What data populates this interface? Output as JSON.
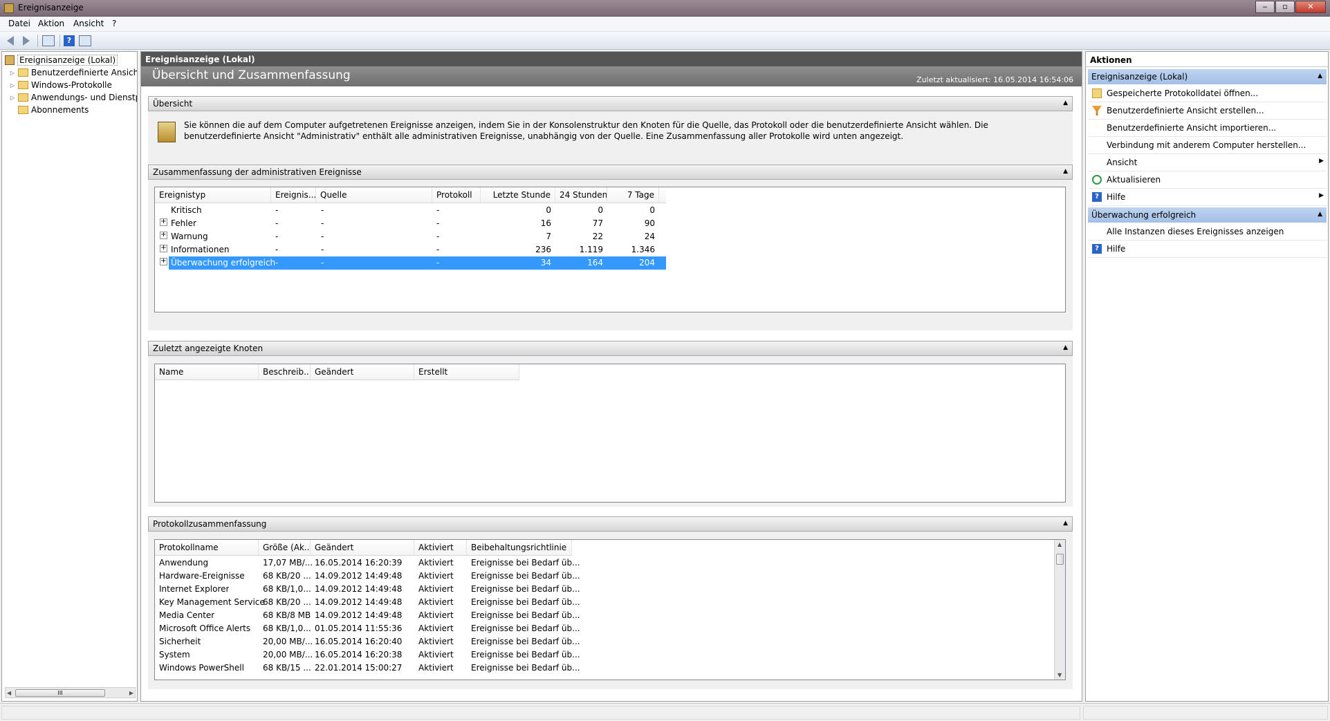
{
  "window": {
    "title": "Ereignisanzeige"
  },
  "menu": [
    "Datei",
    "Aktion",
    "Ansicht",
    "?"
  ],
  "toolbar": {
    "icons": [
      "back-arrow-icon",
      "forward-arrow-icon",
      "show-hide-console-tree-icon",
      "help-icon",
      "show-hide-action-pane-icon"
    ]
  },
  "tree": {
    "root": "Ereignisanzeige (Lokal)",
    "items": [
      {
        "label": "Benutzerdefinierte Ansichten",
        "expandable": true
      },
      {
        "label": "Windows-Protokolle",
        "expandable": true
      },
      {
        "label": "Anwendungs- und Dienstprotokolle",
        "expandable": true
      },
      {
        "label": "Abonnements",
        "expandable": false
      }
    ],
    "scroll_thumb_glyph": "III"
  },
  "center": {
    "header": "Ereignisanzeige (Lokal)",
    "overview_title": "Übersicht und Zusammenfassung",
    "last_updated": "Zuletzt aktualisiert: 16.05.2014 16:54:06",
    "overview": {
      "title": "Übersicht",
      "text": "Sie können die auf dem Computer aufgetretenen Ereignisse anzeigen, indem Sie in der Konsolenstruktur den Knoten für die Quelle, das Protokoll oder die benutzerdefinierte Ansicht wählen. Die benutzerdefinierte Ansicht \"Administrativ\" enthält alle administrativen Ereignisse, unabhängig von der Quelle. Eine Zusammenfassung aller Protokolle wird unten angezeigt."
    },
    "summary": {
      "title": "Zusammenfassung der administrativen Ereignisse",
      "columns": [
        "Ereignistyp",
        "Ereignis...",
        "Quelle",
        "Protokoll",
        "Letzte Stunde",
        "24 Stunden",
        "7 Tage"
      ],
      "rows": [
        {
          "type": "Kritisch",
          "event": "-",
          "source": "-",
          "log": "-",
          "last_hour": "0",
          "h24": "0",
          "d7": "0",
          "expandable": false,
          "selected": false
        },
        {
          "type": "Fehler",
          "event": "-",
          "source": "-",
          "log": "-",
          "last_hour": "16",
          "h24": "77",
          "d7": "90",
          "expandable": true,
          "selected": false
        },
        {
          "type": "Warnung",
          "event": "-",
          "source": "-",
          "log": "-",
          "last_hour": "7",
          "h24": "22",
          "d7": "24",
          "expandable": true,
          "selected": false
        },
        {
          "type": "Informationen",
          "event": "-",
          "source": "-",
          "log": "-",
          "last_hour": "236",
          "h24": "1.119",
          "d7": "1.346",
          "expandable": true,
          "selected": false
        },
        {
          "type": "Überwachung erfolgreich",
          "event": "-",
          "source": "-",
          "log": "-",
          "last_hour": "34",
          "h24": "164",
          "d7": "204",
          "expandable": true,
          "selected": true
        }
      ]
    },
    "recent": {
      "title": "Zuletzt angezeigte Knoten",
      "columns": [
        "Name",
        "Beschreib...",
        "Geändert",
        "Erstellt"
      ]
    },
    "logsummary": {
      "title": "Protokollzusammenfassung",
      "columns": [
        "Protokollname",
        "Größe (Ak...",
        "Geändert",
        "Aktiviert",
        "Beibehaltungsrichtlinie"
      ],
      "rows": [
        {
          "name": "Anwendung",
          "size": "17,07 MB/...",
          "changed": "16.05.2014 16:20:39",
          "enabled": "Aktiviert",
          "policy": "Ereignisse bei Bedarf üb..."
        },
        {
          "name": "Hardware-Ereignisse",
          "size": "68 KB/20 ...",
          "changed": "14.09.2012 14:49:48",
          "enabled": "Aktiviert",
          "policy": "Ereignisse bei Bedarf üb..."
        },
        {
          "name": "Internet Explorer",
          "size": "68 KB/1,0...",
          "changed": "14.09.2012 14:49:48",
          "enabled": "Aktiviert",
          "policy": "Ereignisse bei Bedarf üb..."
        },
        {
          "name": "Key Management Service",
          "size": "68 KB/20 ...",
          "changed": "14.09.2012 14:49:48",
          "enabled": "Aktiviert",
          "policy": "Ereignisse bei Bedarf üb..."
        },
        {
          "name": "Media Center",
          "size": "68 KB/8 MB",
          "changed": "14.09.2012 14:49:48",
          "enabled": "Aktiviert",
          "policy": "Ereignisse bei Bedarf üb..."
        },
        {
          "name": "Microsoft Office Alerts",
          "size": "68 KB/1,0...",
          "changed": "01.05.2014 11:55:36",
          "enabled": "Aktiviert",
          "policy": "Ereignisse bei Bedarf üb..."
        },
        {
          "name": "Sicherheit",
          "size": "20,00 MB/...",
          "changed": "16.05.2014 16:20:40",
          "enabled": "Aktiviert",
          "policy": "Ereignisse bei Bedarf üb..."
        },
        {
          "name": "System",
          "size": "20,00 MB/...",
          "changed": "16.05.2014 16:20:38",
          "enabled": "Aktiviert",
          "policy": "Ereignisse bei Bedarf üb..."
        },
        {
          "name": "Windows PowerShell",
          "size": "68 KB/15 ...",
          "changed": "22.01.2014 15:00:27",
          "enabled": "Aktiviert",
          "policy": "Ereignisse bei Bedarf üb..."
        }
      ]
    }
  },
  "actions": {
    "title": "Aktionen",
    "group1": {
      "title": "Ereignisanzeige (Lokal)",
      "items": [
        {
          "label": "Gespeicherte Protokolldatei öffnen...",
          "icon": "open-folder-icon",
          "submenu": false
        },
        {
          "label": "Benutzerdefinierte Ansicht erstellen...",
          "icon": "filter-icon",
          "submenu": false
        },
        {
          "label": "Benutzerdefinierte Ansicht importieren...",
          "icon": "",
          "submenu": false
        },
        {
          "label": "Verbindung mit anderem Computer herstellen...",
          "icon": "",
          "submenu": false
        },
        {
          "label": "Ansicht",
          "icon": "",
          "submenu": true
        },
        {
          "label": "Aktualisieren",
          "icon": "refresh-icon",
          "submenu": false
        },
        {
          "label": "Hilfe",
          "icon": "help-icon",
          "submenu": true
        }
      ]
    },
    "group2": {
      "title": "Überwachung erfolgreich",
      "items": [
        {
          "label": "Alle Instanzen dieses Ereignisses anzeigen",
          "icon": "",
          "submenu": false
        },
        {
          "label": "Hilfe",
          "icon": "help-icon",
          "submenu": false
        }
      ]
    }
  },
  "colors": {
    "selection": "#3399ff",
    "header_dark": "#555555",
    "action_group": "#b3cbeb"
  }
}
